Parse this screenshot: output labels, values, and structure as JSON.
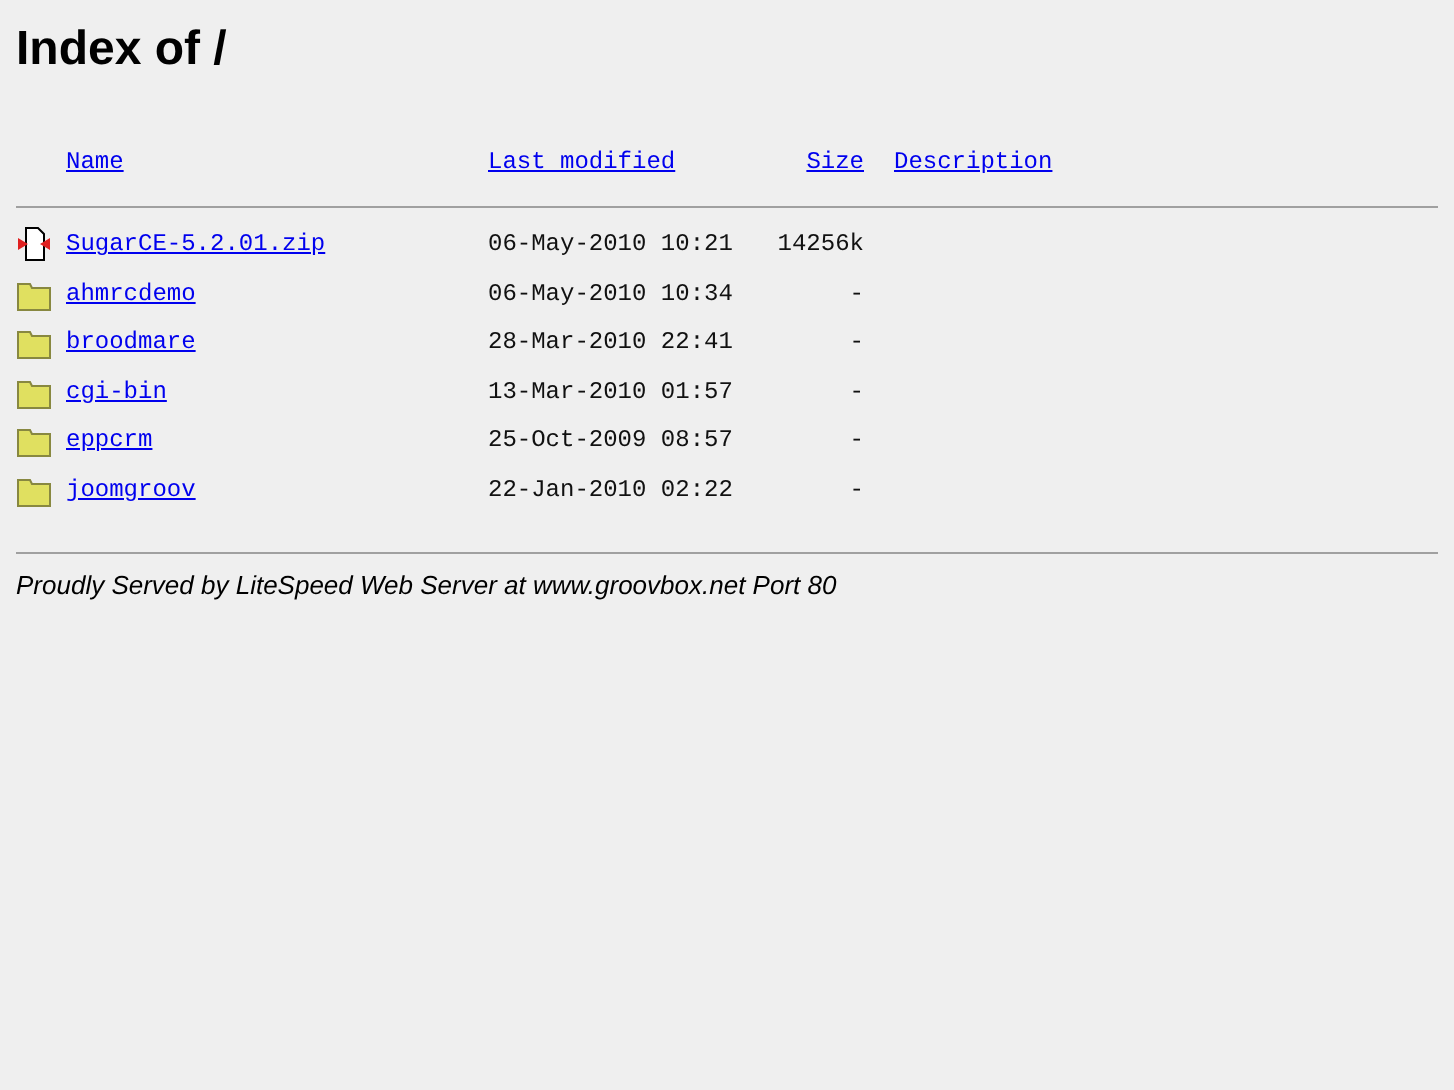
{
  "title": "Index of /",
  "columns": [
    "Name",
    "Last modified",
    "Size",
    "Description"
  ],
  "rows": [
    {
      "kind": "file",
      "name": "SugarCE-5.2.01.zip",
      "modified": "06-May-2010 10:21",
      "size": "14256k"
    },
    {
      "kind": "folder",
      "name": "ahmrcdemo",
      "modified": "06-May-2010 10:34",
      "size": "-"
    },
    {
      "kind": "folder",
      "name": "broodmare",
      "modified": "28-Mar-2010 22:41",
      "size": "-"
    },
    {
      "kind": "folder",
      "name": "cgi-bin",
      "modified": "13-Mar-2010 01:57",
      "size": "-"
    },
    {
      "kind": "folder",
      "name": "eppcrm",
      "modified": "25-Oct-2009 08:57",
      "size": "-"
    },
    {
      "kind": "folder",
      "name": "joomgroov",
      "modified": "22-Jan-2010 02:22",
      "size": "-"
    }
  ],
  "footer": "Proudly Served by LiteSpeed Web Server at www.groovbox.net Port 80"
}
